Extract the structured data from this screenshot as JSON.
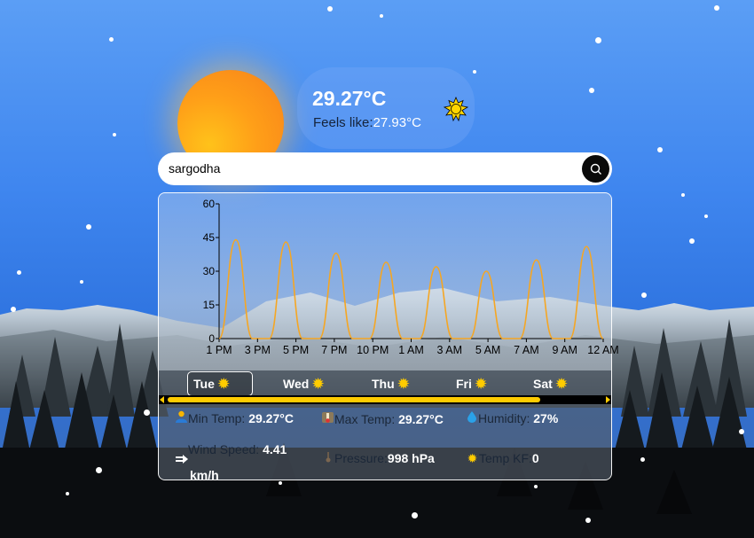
{
  "weather": {
    "temperature": "29.27°C",
    "feels_label": "Feels like:",
    "feels_value": "27.93°C",
    "condition_icon": "sun-icon"
  },
  "search": {
    "value": "sargodha",
    "button_icon": "search-icon"
  },
  "chart_data": {
    "type": "line",
    "color": "#f5a623",
    "ylim": [
      0,
      60
    ],
    "y_ticks": [
      "60",
      "45",
      "30",
      "15",
      "0"
    ],
    "x_tick_labels": [
      "1 PM",
      "3 PM",
      "5 PM",
      "7 PM",
      "10 PM",
      "1 AM",
      "3 AM",
      "5 AM",
      "7 AM",
      "9 AM",
      "12 AM"
    ],
    "series": [
      {
        "values": [
          0,
          44,
          0,
          0,
          43,
          0,
          0,
          38,
          0,
          0,
          34,
          0,
          0,
          32,
          0,
          0,
          30,
          0,
          0,
          35,
          0,
          0,
          41,
          0
        ]
      }
    ]
  },
  "days": [
    {
      "label": "Tue",
      "icon": "sun-icon",
      "active": true
    },
    {
      "label": "Wed",
      "icon": "sun-icon"
    },
    {
      "label": "Thu",
      "icon": "sun-icon"
    },
    {
      "label": "Fri",
      "icon": "sun-icon"
    },
    {
      "label": "Sat",
      "icon": "sun-icon"
    }
  ],
  "stats": {
    "min_temp": {
      "label": "Min Temp:",
      "value": "29.27°C",
      "icon": "person-icon"
    },
    "max_temp": {
      "label": "Max Temp:",
      "value": "29.27°C",
      "icon": "thermometer-icon"
    },
    "humidity": {
      "label": "Humidity:",
      "value": "27%",
      "icon": "droplet-icon"
    },
    "wind": {
      "label": "Wind Speed:",
      "value": "4.41",
      "unit": "km/h",
      "icon": "wind-icon"
    },
    "pressure": {
      "label": "Pressure:",
      "value": "998 hPa",
      "icon": "pressure-icon"
    },
    "temp_kf": {
      "label": "Temp KF:",
      "value": "0",
      "icon": "sun-icon"
    }
  },
  "colors": {
    "accent": "#ffcc00",
    "line": "#f5a623"
  }
}
